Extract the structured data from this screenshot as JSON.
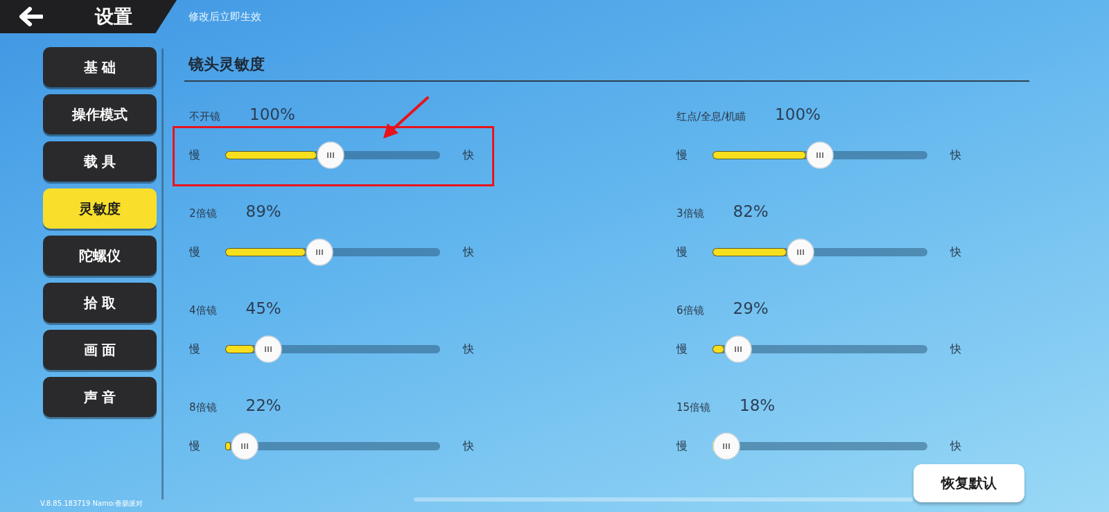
{
  "header": {
    "title": "设置",
    "hint": "修改后立即生效"
  },
  "sidebar": {
    "items": [
      {
        "label": "基 础",
        "selected": false
      },
      {
        "label": "操作模式",
        "selected": false
      },
      {
        "label": "载 具",
        "selected": false
      },
      {
        "label": "灵敏度",
        "selected": true
      },
      {
        "label": "陀螺仪",
        "selected": false
      },
      {
        "label": "拾 取",
        "selected": false
      },
      {
        "label": "画 面",
        "selected": false
      },
      {
        "label": "声 音",
        "selected": false
      }
    ],
    "version": "V.8.85.183719 Namo:香肠派对"
  },
  "section": {
    "title": "镜头灵敏度",
    "sliders": [
      {
        "label": "不开镜",
        "reading": "100%",
        "min_label": "慢",
        "max_label": "快",
        "level": 0.49,
        "highlighted": true
      },
      {
        "label": "红点/全息/机瞄",
        "reading": "100%",
        "min_label": "慢",
        "max_label": "快",
        "level": 0.5,
        "highlighted": false
      },
      {
        "label": "2倍镜",
        "reading": "89%",
        "min_label": "慢",
        "max_label": "快",
        "level": 0.44,
        "highlighted": false
      },
      {
        "label": "3倍镜",
        "reading": "82%",
        "min_label": "慢",
        "max_label": "快",
        "level": 0.41,
        "highlighted": false
      },
      {
        "label": "4倍镜",
        "reading": "45%",
        "min_label": "慢",
        "max_label": "快",
        "level": 0.2,
        "highlighted": false
      },
      {
        "label": "6倍镜",
        "reading": "29%",
        "min_label": "慢",
        "max_label": "快",
        "level": 0.12,
        "highlighted": false
      },
      {
        "label": "8倍镜",
        "reading": "22%",
        "min_label": "慢",
        "max_label": "快",
        "level": 0.09,
        "highlighted": false
      },
      {
        "label": "15倍镜",
        "reading": "18%",
        "min_label": "慢",
        "max_label": "快",
        "level": 0.065,
        "highlighted": false
      }
    ]
  },
  "reset_button": "恢复默认"
}
